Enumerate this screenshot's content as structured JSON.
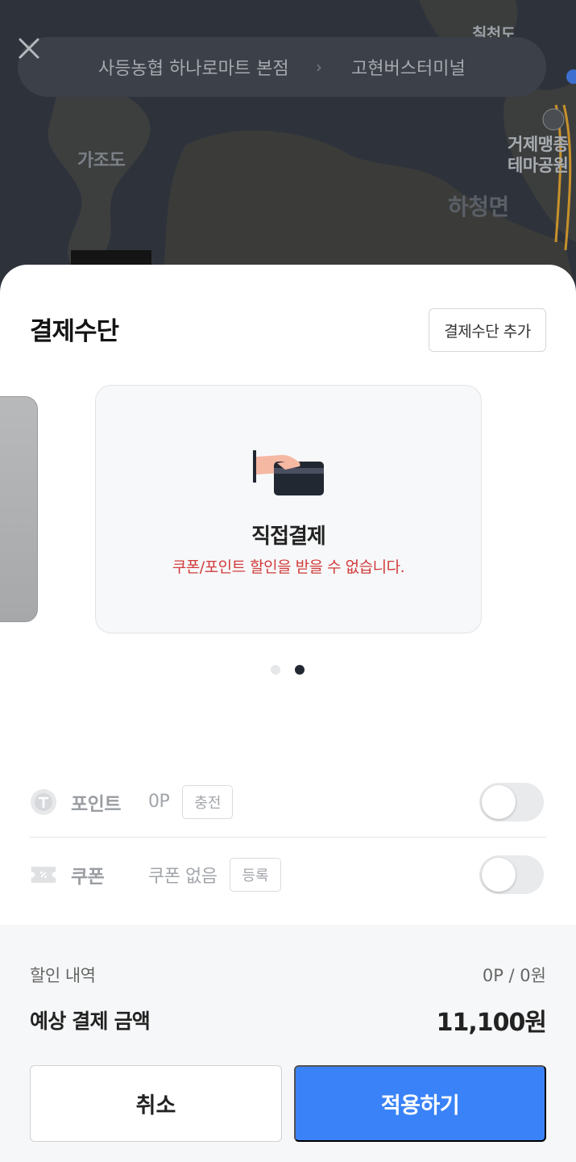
{
  "map": {
    "labels": {
      "chilcheon": "칠천도",
      "gajo": "가조도",
      "hacheong": "하청면",
      "park_line1": "거제맹종",
      "park_line2": "테마공원"
    },
    "route": {
      "from": "사등농협 하나로마트 본점",
      "arrow": "›",
      "to": "고현버스터미널"
    }
  },
  "sheet": {
    "title": "결제수단",
    "add_method_label": "결제수단 추가",
    "card": {
      "title": "직접결제",
      "warning": "쿠폰/포인트 할인을 받을 수 없습니다."
    },
    "pager": {
      "total": 2,
      "active": 2
    },
    "point": {
      "label": "포인트",
      "value": "0P",
      "button": "충전",
      "enabled": false
    },
    "coupon": {
      "label": "쿠폰",
      "value": "쿠폰 없음",
      "button": "등록",
      "enabled": false
    }
  },
  "summary": {
    "discount_label": "할인 내역",
    "discount_value": "0P / 0원",
    "payment_label": "예상 결제 금액",
    "payment_value": "11,100원",
    "cancel_label": "취소",
    "apply_label": "적용하기"
  },
  "colors": {
    "accent": "#3a82f7",
    "warning": "#d23b3b",
    "map_bg": "#30353d"
  }
}
